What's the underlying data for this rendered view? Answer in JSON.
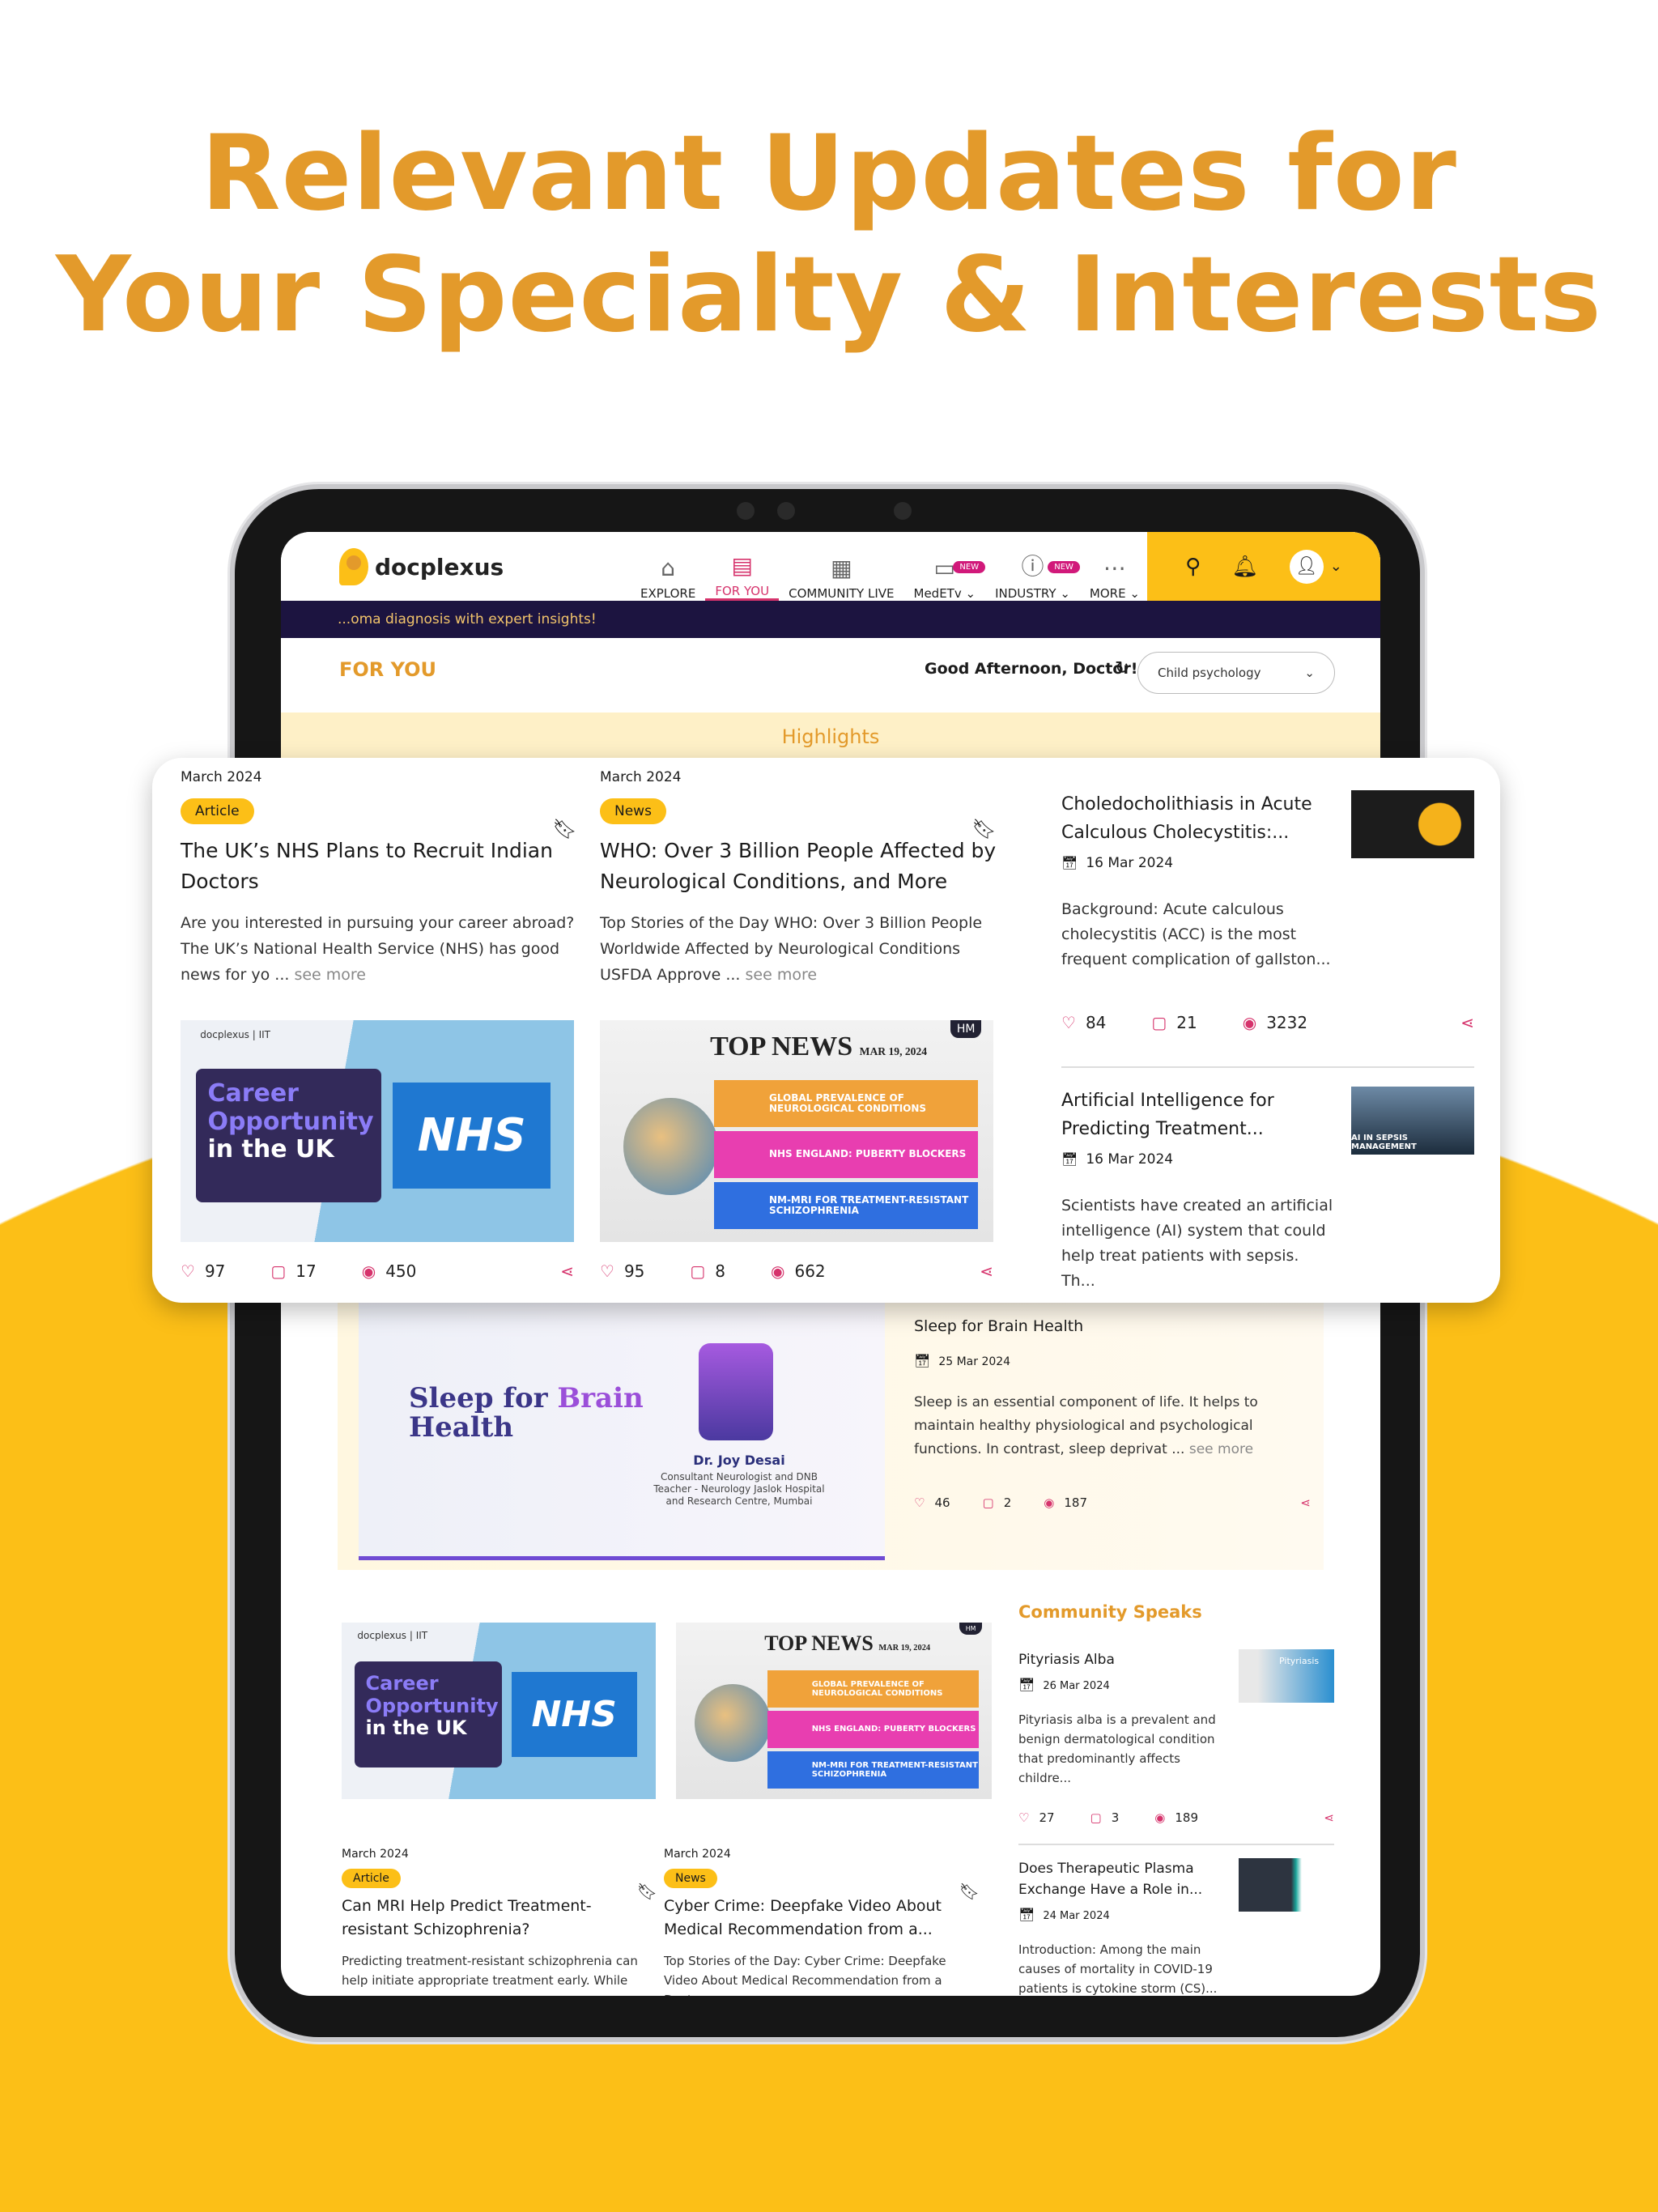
{
  "hero": {
    "line1": "Relevant Updates for",
    "line2": "Your Specialty & Interests"
  },
  "colors": {
    "accent_orange": "#E39A2B",
    "brand_yellow": "#FCBF17",
    "pink": "#D6336C",
    "ticker_bg": "#1C1440",
    "highlight_bg": "#FEF0C7"
  },
  "nav": {
    "logo": "docplexus",
    "items": [
      {
        "label": "EXPLORE",
        "icon": "home-icon"
      },
      {
        "label": "FOR YOU",
        "icon": "newspaper-icon",
        "active": true
      },
      {
        "label": "COMMUNITY LIVE",
        "icon": "live-calendar-icon"
      },
      {
        "label": "MedETv",
        "icon": "tv-icon",
        "badge": "NEW",
        "dropdown": true
      },
      {
        "label": "INDUSTRY",
        "icon": "info-icon",
        "badge": "NEW",
        "dropdown": true
      },
      {
        "label": "MORE",
        "icon": "more-icon",
        "dropdown": true
      }
    ]
  },
  "ticker": "...oma diagnosis with expert insights!",
  "page": {
    "title": "FOR YOU",
    "greeting": "Good Afternoon, Doctor!",
    "specialty": "Child psychology",
    "highlights": "Highlights"
  },
  "highlights": [
    {
      "month": "March 2024",
      "type": "Article",
      "title": "The UK’s NHS Plans to Recruit Indian Doctors",
      "body": "Are you interested in pursuing your career abroad? The UK’s National Health Service (NHS) has good news for yo ...",
      "see_more": "see more",
      "likes": "97",
      "comments": "17",
      "views": "450"
    },
    {
      "month": "March 2024",
      "type": "News",
      "title": "WHO: Over 3 Billion People Affected by Neurological Conditions, and More",
      "body": "Top Stories of the Day WHO: Over 3 Billion People Worldwide Affected by Neurological Conditions USFDA Approve ...",
      "see_more": "see more",
      "likes": "95",
      "comments": "8",
      "views": "662"
    }
  ],
  "images": {
    "nhs": {
      "logo": "docplexus | IIT",
      "line1": "Career",
      "line2": "Opportunity",
      "line3": "in the UK",
      "nhs": "NHS"
    },
    "topnews": {
      "title": "TOP NEWS",
      "date": "MAR 19, 2024",
      "hm": "HM",
      "rows": [
        "GLOBAL PREVALENCE OF NEUROLOGICAL CONDITIONS",
        "NHS ENGLAND: PUBERTY BLOCKERS",
        "NM-MRI FOR TREATMENT-RESISTANT SCHIZOPHRENIA"
      ]
    }
  },
  "side": [
    {
      "title": "Choledocholithiasis in Acute Calculous Cholecystitis:...",
      "date": "16 Mar 2024",
      "body": "Background: Acute calculous cholecystitis (ACC) is the most frequent complication of gallston...",
      "likes": "84",
      "comments": "21",
      "views": "3232"
    },
    {
      "title": "Artificial Intelligence for Predicting Treatment...",
      "date": "16 Mar 2024",
      "body": "Scientists have created an artificial intelligence (AI) system that could help treat patients with sepsis. Th...",
      "image_caption": "AI IN SEPSIS MANAGEMENT"
    }
  ],
  "sleep": {
    "image_title1": "Sleep for",
    "image_title2": "Brain",
    "image_title3": "Health",
    "doctor": "Dr. Joy Desai",
    "role": "Consultant Neurologist and DNB Teacher - Neurology Jaslok Hospital and Research Centre, Mumbai",
    "title": "Sleep for Brain Health",
    "date": "25 Mar 2024",
    "body": "Sleep is an essential component of life. It helps to maintain healthy physiological and psychological functions. In contrast, sleep deprivat ...",
    "see_more": "see more",
    "likes": "46",
    "comments": "2",
    "views": "187"
  },
  "community": {
    "heading": "Community Speaks",
    "items": [
      {
        "title": "Pityriasis Alba",
        "date": "26 Mar 2024",
        "body": "Pityriasis alba is a prevalent and benign dermatological condition that predominantly affects childre...",
        "likes": "27",
        "comments": "3",
        "views": "189",
        "image_caption": "Pityriasis"
      },
      {
        "title": "Does Therapeutic Plasma Exchange Have a Role in...",
        "date": "24 Mar 2024",
        "body": "Introduction: Among the main causes of mortality in COVID-19 patients is cytokine storm (CS)..."
      }
    ]
  },
  "bottom_articles": [
    {
      "month": "March 2024",
      "type": "Article",
      "title": "Can MRI Help Predict Treatment-resistant Schizophrenia?",
      "body": "Predicting treatment-resistant schizophrenia can help initiate appropriate treatment early. While"
    },
    {
      "month": "March 2024",
      "type": "News",
      "title": "Cyber Crime: Deepfake Video About Medical Recommendation from a...",
      "body": "Top Stories of the Day: Cyber Crime: Deepfake Video About Medical Recommendation from a Doctor"
    }
  ]
}
